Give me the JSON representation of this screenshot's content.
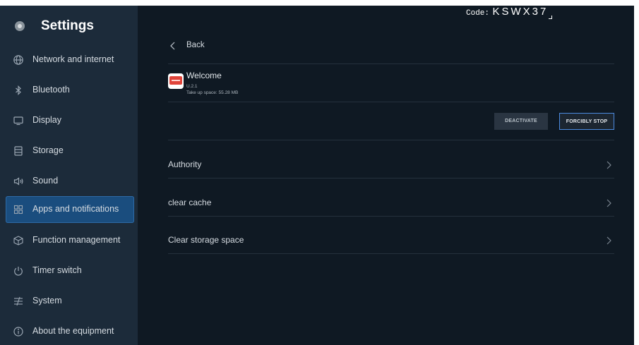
{
  "sidebar": {
    "title": "Settings",
    "items": [
      {
        "label": "Network and internet",
        "icon": "globe-icon",
        "active": false
      },
      {
        "label": "Bluetooth",
        "icon": "bluetooth-icon",
        "active": false
      },
      {
        "label": "Display",
        "icon": "monitor-icon",
        "active": false
      },
      {
        "label": "Storage",
        "icon": "storage-icon",
        "active": false
      },
      {
        "label": "Sound",
        "icon": "speaker-icon",
        "active": false
      },
      {
        "label": "Apps and notifications",
        "icon": "apps-grid-icon",
        "active": true
      },
      {
        "label": "Function management",
        "icon": "cube-icon",
        "active": false
      },
      {
        "label": "Timer switch",
        "icon": "power-icon",
        "active": false
      },
      {
        "label": "System",
        "icon": "sliders-icon",
        "active": false
      },
      {
        "label": "About the equipment",
        "icon": "info-icon",
        "active": false
      }
    ]
  },
  "header": {
    "code_label": "Code:",
    "code_value": "KSWX37"
  },
  "back_label": "Back",
  "app": {
    "name": "Welcome",
    "version": "U.2.1",
    "size": "Take up space: 55.28 MB"
  },
  "actions": {
    "deactivate": "DEACTIVATE",
    "force_stop": "FORCIBLY STOP"
  },
  "rows": [
    {
      "label": "Authority"
    },
    {
      "label": "clear cache"
    },
    {
      "label": "Clear storage space"
    }
  ],
  "colors": {
    "background": "#0f1923",
    "sidebar": "#1c2b3a",
    "active_item": "#1a4d7e",
    "accent_border": "#4c8be0"
  }
}
